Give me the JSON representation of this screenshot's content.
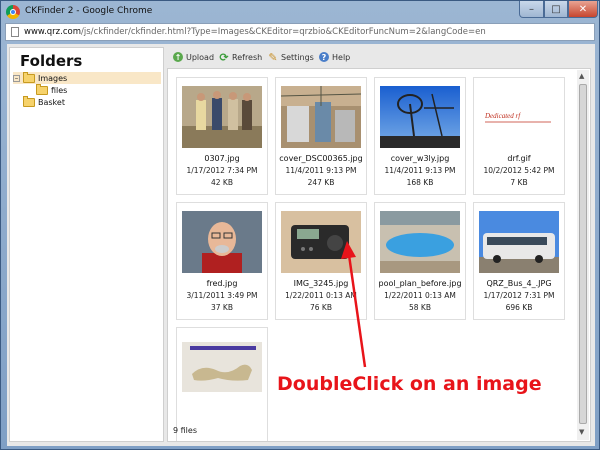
{
  "window": {
    "title": "CKFinder 2 - Google Chrome",
    "controls": {
      "minimize": "–",
      "maximize": "□",
      "close": "✕"
    }
  },
  "address_bar": {
    "host": "www.qrz.com",
    "path": "/js/ckfinder/ckfinder.html?Type=Images&CKEditor=qrzbio&CKEditorFuncNum=2&langCode=en"
  },
  "folders": {
    "title": "Folders",
    "items": [
      {
        "label": "Images",
        "expander": "–",
        "selected": true
      },
      {
        "label": "files",
        "expander": "",
        "selected": false
      },
      {
        "label": "Basket",
        "expander": "",
        "selected": false
      }
    ]
  },
  "toolbar": {
    "upload": "Upload",
    "refresh": "Refresh",
    "settings": "Settings",
    "help": "Help"
  },
  "files": [
    {
      "name": "0307.jpg",
      "date": "1/17/2012 7:34 PM",
      "size": "42 KB"
    },
    {
      "name": "cover_DSC00365.jpg",
      "date": "11/4/2011 9:13 PM",
      "size": "247 KB"
    },
    {
      "name": "cover_w3ly.jpg",
      "date": "11/4/2011 9:13 PM",
      "size": "168 KB"
    },
    {
      "name": "drf.gif",
      "date": "10/2/2012 5:42 PM",
      "size": "7 KB",
      "thumb_text": "Dedicated rf"
    },
    {
      "name": "fred.jpg",
      "date": "3/11/2011 3:49 PM",
      "size": "37 KB"
    },
    {
      "name": "IMG_3245.jpg",
      "date": "1/22/2011 0:13 AM",
      "size": "76 KB"
    },
    {
      "name": "pool_plan_before.jpg",
      "date": "1/22/2011 0:13 AM",
      "size": "58 KB"
    },
    {
      "name": "QRZ_Bus_4_.JPG",
      "date": "1/17/2012 7:31 PM",
      "size": "696 KB"
    },
    {
      "name": "",
      "date": "",
      "size": ""
    }
  ],
  "status": {
    "text": "9 files"
  },
  "annotation": {
    "text": "DoubleClick on an image",
    "color": "#e8141a"
  },
  "colors": {
    "selected_folder": "#f9e7c7",
    "titlebar": "#9cb6d3"
  }
}
